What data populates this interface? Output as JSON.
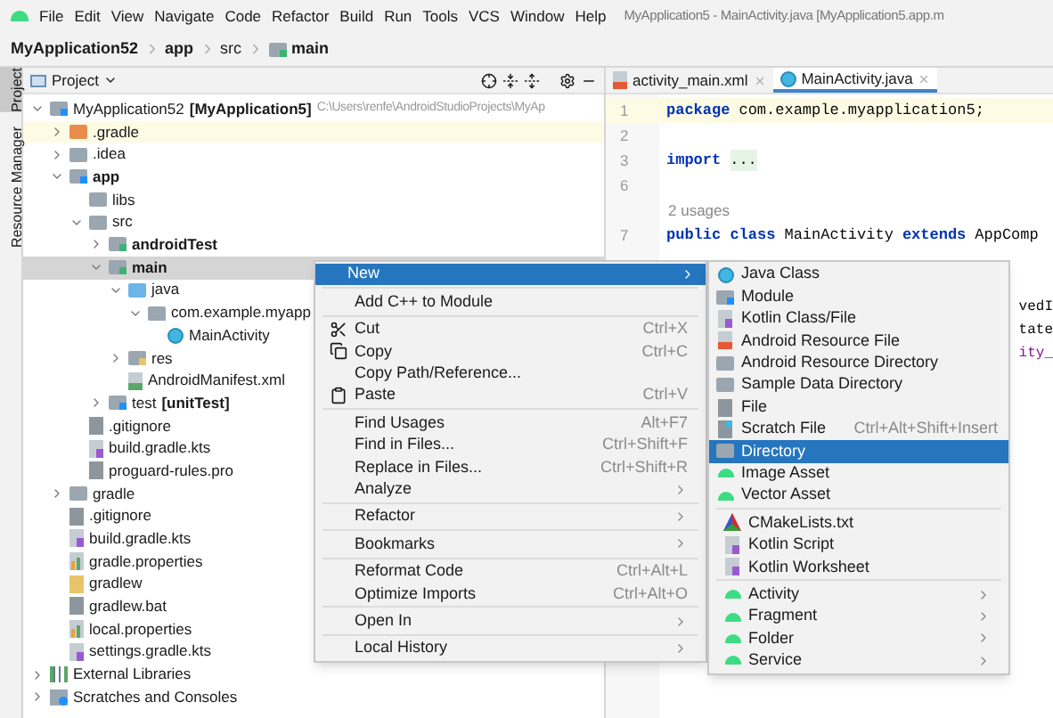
{
  "menu_bar": {
    "items": [
      "File",
      "Edit",
      "View",
      "Navigate",
      "Code",
      "Refactor",
      "Build",
      "Run",
      "Tools",
      "VCS",
      "Window",
      "Help"
    ],
    "title": "MyApplication5 - MainActivity.java [MyApplication5.app.m"
  },
  "breadcrumb": [
    {
      "label": "MyApplication52",
      "bold": true,
      "kind": "plain"
    },
    {
      "label": "app",
      "bold": true,
      "kind": "plain"
    },
    {
      "label": "src",
      "bold": false,
      "kind": "plain"
    },
    {
      "label": "main",
      "bold": true,
      "kind": "source-folder"
    }
  ],
  "tool_strip": [
    {
      "label": "Project",
      "selected": true
    },
    {
      "label": "Resource Manager",
      "selected": false
    }
  ],
  "project_panel": {
    "title": "Project",
    "tree": [
      {
        "label": "MyApplication52",
        "suffix": "[MyApplication5]",
        "path": "C:\\Users\\renfe\\AndroidStudioProjects\\MyAp",
        "kind": "module",
        "bold": false,
        "expanded": true,
        "selected": false,
        "children": [
          {
            "label": ".gradle",
            "kind": "excluded-folder",
            "bold": false,
            "expanded": false,
            "selected": false,
            "ignored": true
          },
          {
            "label": ".idea",
            "kind": "folder",
            "bold": false,
            "expanded": false,
            "selected": false
          },
          {
            "label": "app",
            "kind": "module",
            "bold": true,
            "expanded": true,
            "selected": false,
            "children": [
              {
                "label": "libs",
                "kind": "folder",
                "bold": false,
                "selected": false
              },
              {
                "label": "src",
                "kind": "folder",
                "bold": false,
                "expanded": true,
                "selected": false,
                "children": [
                  {
                    "label": "androidTest",
                    "kind": "source-folder",
                    "bold": true,
                    "expanded": false,
                    "selected": false
                  },
                  {
                    "label": "main",
                    "kind": "source-folder",
                    "bold": true,
                    "expanded": true,
                    "selected": true,
                    "children": [
                      {
                        "label": "java",
                        "kind": "java-folder",
                        "bold": false,
                        "expanded": true,
                        "selected": false,
                        "children": [
                          {
                            "label": "com.example.myapp",
                            "kind": "package",
                            "bold": false,
                            "expanded": true,
                            "selected": false,
                            "children": [
                              {
                                "label": "MainActivity",
                                "kind": "class",
                                "bold": false,
                                "selected": false
                              }
                            ]
                          }
                        ]
                      },
                      {
                        "label": "res",
                        "kind": "res-folder",
                        "bold": false,
                        "expanded": false,
                        "selected": false
                      },
                      {
                        "label": "AndroidManifest.xml",
                        "kind": "manifest",
                        "bold": false,
                        "selected": false
                      }
                    ]
                  },
                  {
                    "label": "test",
                    "suffix": "[unitTest]",
                    "kind": "test-folder",
                    "bold": false,
                    "expanded": false,
                    "selected": false
                  }
                ]
              },
              {
                "label": ".gitignore",
                "kind": "gitignore",
                "bold": false,
                "selected": false
              },
              {
                "label": "build.gradle.kts",
                "kind": "kotlin-file",
                "bold": false,
                "selected": false
              },
              {
                "label": "proguard-rules.pro",
                "kind": "file",
                "bold": false,
                "selected": false
              }
            ]
          },
          {
            "label": "gradle",
            "kind": "folder",
            "bold": false,
            "expanded": false,
            "selected": false
          },
          {
            "label": ".gitignore",
            "kind": "gitignore",
            "bold": false,
            "selected": false
          },
          {
            "label": "build.gradle.kts",
            "kind": "kotlin-file",
            "bold": false,
            "selected": false
          },
          {
            "label": "gradle.properties",
            "kind": "properties",
            "bold": false,
            "selected": false
          },
          {
            "label": "gradlew",
            "kind": "shell",
            "bold": false,
            "selected": false
          },
          {
            "label": "gradlew.bat",
            "kind": "file",
            "bold": false,
            "selected": false
          },
          {
            "label": "local.properties",
            "kind": "properties",
            "bold": false,
            "selected": false
          },
          {
            "label": "settings.gradle.kts",
            "kind": "kotlin-file",
            "bold": false,
            "selected": false
          }
        ]
      },
      {
        "label": "External Libraries",
        "kind": "library",
        "bold": false,
        "expanded": false,
        "selected": false
      },
      {
        "label": "Scratches and Consoles",
        "kind": "scratches",
        "bold": false,
        "expanded": false,
        "selected": false
      }
    ]
  },
  "editor": {
    "tabs": [
      {
        "label": "activity_main.xml",
        "kind": "xml",
        "selected": false
      },
      {
        "label": "MainActivity.java",
        "kind": "class",
        "selected": true
      }
    ],
    "lines": [
      {
        "kind": "code",
        "number": "1",
        "current": true,
        "tokens": [
          {
            "text": "package",
            "kind": "keyword"
          },
          {
            "text": "com.example.myapplication5;",
            "kind": "plain"
          }
        ]
      },
      {
        "kind": "code",
        "number": "2",
        "current": false
      },
      {
        "kind": "code",
        "number": "3",
        "current": false,
        "tokens": [
          {
            "text": "import",
            "kind": "keyword"
          },
          {
            "text": "...",
            "kind": "folded"
          }
        ]
      },
      {
        "kind": "code",
        "number": "6",
        "current": false
      },
      {
        "kind": "hint",
        "text": "2 usages"
      },
      {
        "kind": "code",
        "number": "7",
        "current": false,
        "tokens": [
          {
            "text": "public class",
            "kind": "keyword"
          },
          {
            "text": "MainActivity",
            "kind": "plain"
          },
          {
            "text": "extends",
            "kind": "keyword"
          },
          {
            "text": "AppComp",
            "kind": "plain"
          }
        ]
      }
    ],
    "fragments": [
      {
        "text": "vedI",
        "kind": "plain"
      },
      {
        "text": "tate",
        "kind": "plain"
      },
      {
        "text": "ity_",
        "kind": "field"
      }
    ]
  },
  "context_menu": {
    "groups": [
      [
        {
          "label": "New",
          "submenu": true,
          "kind": "plain",
          "selected": true
        }
      ],
      [
        {
          "label": "Add C++ to Module",
          "kind": "plain",
          "selected": false
        }
      ],
      [
        {
          "label": "Cut",
          "shortcut": "Ctrl+X",
          "kind": "cut",
          "selected": false
        },
        {
          "label": "Copy",
          "shortcut": "Ctrl+C",
          "kind": "copy",
          "selected": false
        },
        {
          "label": "Copy Path/Reference...",
          "kind": "plain",
          "selected": false
        },
        {
          "label": "Paste",
          "shortcut": "Ctrl+V",
          "kind": "paste",
          "selected": false
        }
      ],
      [
        {
          "label": "Find Usages",
          "shortcut": "Alt+F7",
          "kind": "plain",
          "selected": false
        },
        {
          "label": "Find in Files...",
          "shortcut": "Ctrl+Shift+F",
          "kind": "plain",
          "selected": false
        },
        {
          "label": "Replace in Files...",
          "shortcut": "Ctrl+Shift+R",
          "kind": "plain",
          "selected": false
        },
        {
          "label": "Analyze",
          "submenu": true,
          "kind": "plain",
          "selected": false
        }
      ],
      [
        {
          "label": "Refactor",
          "submenu": true,
          "kind": "plain",
          "selected": false
        }
      ],
      [
        {
          "label": "Bookmarks",
          "submenu": true,
          "kind": "plain",
          "selected": false
        }
      ],
      [
        {
          "label": "Reformat Code",
          "shortcut": "Ctrl+Alt+L",
          "kind": "plain",
          "selected": false
        },
        {
          "label": "Optimize Imports",
          "shortcut": "Ctrl+Alt+O",
          "kind": "plain",
          "selected": false
        }
      ],
      [
        {
          "label": "Open In",
          "submenu": true,
          "kind": "plain",
          "selected": false
        }
      ],
      [
        {
          "label": "Local History",
          "submenu": true,
          "kind": "plain",
          "selected": false
        }
      ]
    ]
  },
  "new_submenu": {
    "groups": [
      [
        {
          "label": "Java Class",
          "kind": "class",
          "selected": false
        },
        {
          "label": "Module",
          "kind": "module",
          "selected": false
        },
        {
          "label": "Kotlin Class/File",
          "kind": "kotlin-file",
          "selected": false
        },
        {
          "label": "Android Resource File",
          "kind": "xml",
          "selected": false
        },
        {
          "label": "Android Resource Directory",
          "kind": "folder",
          "selected": false
        },
        {
          "label": "Sample Data Directory",
          "kind": "folder",
          "selected": false
        },
        {
          "label": "File",
          "kind": "file",
          "selected": false
        },
        {
          "label": "Scratch File",
          "shortcut": "Ctrl+Alt+Shift+Insert",
          "kind": "scratch",
          "selected": false
        },
        {
          "label": "Directory",
          "kind": "folder",
          "selected": true
        },
        {
          "label": "Image Asset",
          "kind": "android",
          "selected": false
        },
        {
          "label": "Vector Asset",
          "kind": "android",
          "selected": false
        }
      ],
      [
        {
          "label": "CMakeLists.txt",
          "kind": "cmake",
          "selected": false
        },
        {
          "label": "Kotlin Script",
          "kind": "kotlin-file",
          "selected": false
        },
        {
          "label": "Kotlin Worksheet",
          "kind": "kotlin-file",
          "selected": false
        }
      ],
      [
        {
          "label": "Activity",
          "submenu": true,
          "kind": "android",
          "selected": false
        },
        {
          "label": "Fragment",
          "submenu": true,
          "kind": "android",
          "selected": false
        },
        {
          "label": "Folder",
          "submenu": true,
          "kind": "android",
          "selected": false
        },
        {
          "label": "Service",
          "submenu": true,
          "kind": "android",
          "selected": false
        }
      ]
    ]
  }
}
